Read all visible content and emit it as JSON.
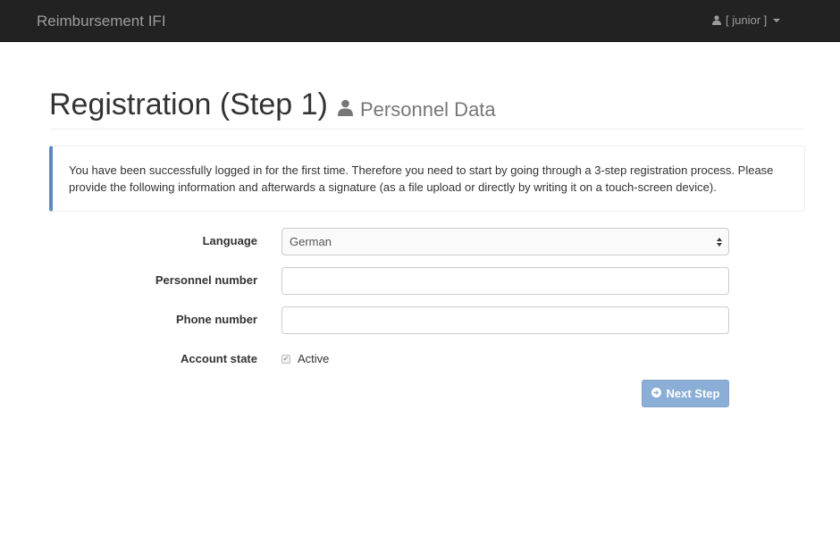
{
  "navbar": {
    "brand": "Reimbursement IFI",
    "user_label": "[ junior ]",
    "user_icon": "user-icon",
    "menu_icon": "caret-down-icon"
  },
  "header": {
    "title": "Registration (Step 1)",
    "subtitle": "Personnel Data",
    "subtitle_icon": "user-icon"
  },
  "callout": {
    "text": "You have been successfully logged in for the first time. Therefore you need to start by going through a 3-step registration process. Please provide the following information and afterwards a signature (as a file upload or directly by writing it on a touch-screen device).",
    "accent_color": "#5b8bbe"
  },
  "form": {
    "language": {
      "label": "Language",
      "selected": "German"
    },
    "personnel_number": {
      "label": "Personnel number",
      "value": ""
    },
    "phone_number": {
      "label": "Phone number",
      "value": ""
    },
    "account_state": {
      "label": "Account state",
      "checkbox_label": "Active",
      "checked": true
    },
    "next_button": {
      "label": "Next Step",
      "icon": "circle-arrow-right-icon",
      "color": "#8aaed6"
    }
  }
}
